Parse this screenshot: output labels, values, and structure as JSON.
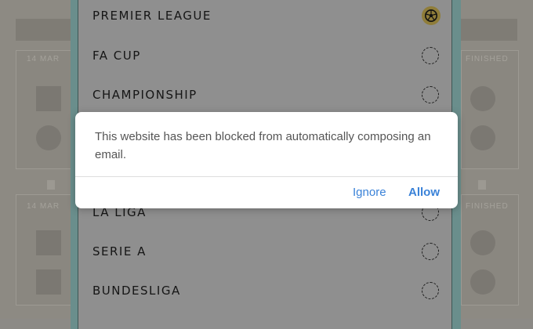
{
  "background": {
    "date_labels": [
      "14 MAR",
      "14 MAR"
    ],
    "status_labels": [
      "FINISHED",
      "FINISHED"
    ]
  },
  "leagues": [
    {
      "label": "PREMIER LEAGUE",
      "selected": true
    },
    {
      "label": "FA CUP",
      "selected": false
    },
    {
      "label": "CHAMPIONSHIP",
      "selected": false
    },
    {
      "label": "LA LIGA",
      "selected": false
    },
    {
      "label": "SERIE A",
      "selected": false
    },
    {
      "label": "BUNDESLIGA",
      "selected": false
    }
  ],
  "dialog": {
    "message": "This website has been blocked from automatically composing an email.",
    "ignore_label": "Ignore",
    "allow_label": "Allow"
  },
  "colors": {
    "accent": "#3a82d8",
    "panel_border": "#6a8e8c",
    "selected_radio": "#8f7d3a"
  },
  "icons": {
    "selected_radio": "soccer-ball-icon"
  }
}
